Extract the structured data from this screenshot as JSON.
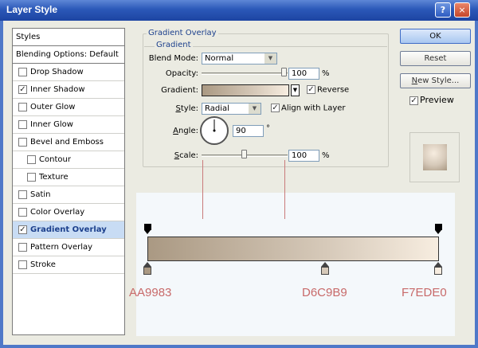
{
  "window": {
    "title": "Layer Style",
    "help_glyph": "?",
    "close_glyph": "×"
  },
  "styles_list": {
    "header": "Styles",
    "blending_options": "Blending Options: Default",
    "items": [
      {
        "label": "Drop Shadow",
        "checked": false,
        "sub": false
      },
      {
        "label": "Inner Shadow",
        "checked": true,
        "sub": false
      },
      {
        "label": "Outer Glow",
        "checked": false,
        "sub": false
      },
      {
        "label": "Inner Glow",
        "checked": false,
        "sub": false
      },
      {
        "label": "Bevel and Emboss",
        "checked": false,
        "sub": false
      },
      {
        "label": "Contour",
        "checked": false,
        "sub": true
      },
      {
        "label": "Texture",
        "checked": false,
        "sub": true
      },
      {
        "label": "Satin",
        "checked": false,
        "sub": false
      },
      {
        "label": "Color Overlay",
        "checked": false,
        "sub": false
      },
      {
        "label": "Gradient Overlay",
        "checked": true,
        "sub": false,
        "selected": true
      },
      {
        "label": "Pattern Overlay",
        "checked": false,
        "sub": false
      },
      {
        "label": "Stroke",
        "checked": false,
        "sub": false
      }
    ]
  },
  "panel": {
    "group_title": "Gradient Overlay",
    "sub_title": "Gradient",
    "blend_mode_label": "Blend Mode:",
    "blend_mode_value": "Normal",
    "opacity_label": "Opacity:",
    "opacity_value": "100",
    "opacity_unit": "%",
    "opacity_level": 1.0,
    "gradient_label": "Gradient:",
    "reverse_label": "Reverse",
    "reverse_checked": true,
    "style_label": "Style:",
    "style_value": "Radial",
    "align_label": "Align with Layer",
    "align_checked": true,
    "angle_label": "Angle:",
    "angle_value": "90",
    "angle_unit": "°",
    "scale_label": "Scale:",
    "scale_value": "100",
    "scale_unit": "%",
    "scale_level": 0.5
  },
  "buttons": {
    "ok": "OK",
    "reset": "Reset",
    "new_style": "New Style...",
    "preview_label": "Preview",
    "preview_checked": true
  },
  "gradient": {
    "stops": [
      {
        "hex": "AA9983",
        "color": "#AA9983",
        "location": 0
      },
      {
        "hex": "D6C9B9",
        "color": "#D6C9B9",
        "location": 0.61
      },
      {
        "hex": "F7EDE0",
        "color": "#F7EDE0",
        "location": 1
      }
    ],
    "opacity_stops": [
      0,
      1
    ]
  },
  "colors": {
    "accent": "#1B3F8C",
    "selection": "#C8DCF4",
    "hex_label": "#C86A6A"
  }
}
